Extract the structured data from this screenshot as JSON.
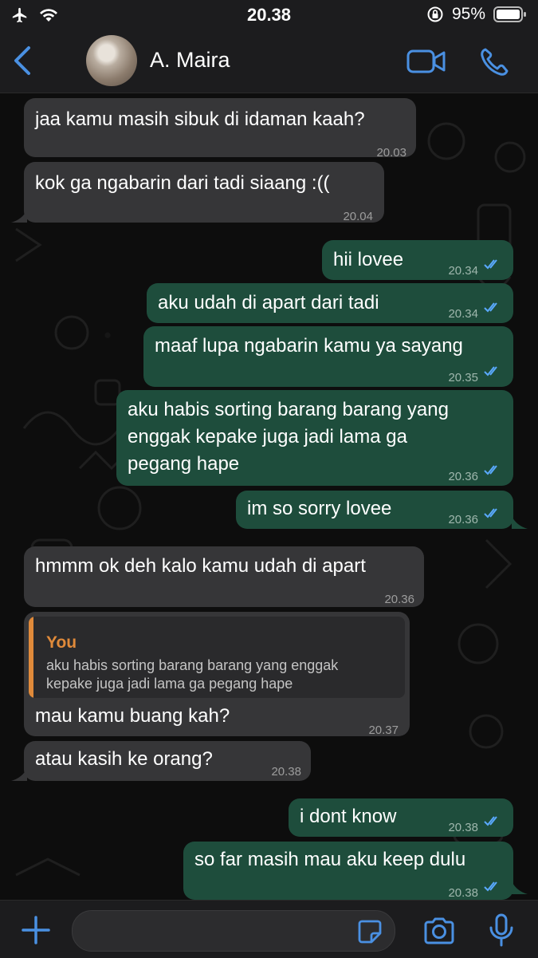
{
  "status_bar": {
    "time": "20.38",
    "battery": "95%"
  },
  "header": {
    "contact_name": "A. Maira"
  },
  "messages": [
    {
      "text": "jaa kamu masih sibuk di idaman kaah?",
      "time": "20.03",
      "direction": "incoming"
    },
    {
      "text": "kok ga ngabarin dari tadi siaang :((",
      "time": "20.04",
      "direction": "incoming"
    },
    {
      "text": "hii lovee",
      "time": "20.34",
      "direction": "outgoing",
      "status": "read"
    },
    {
      "text": "aku udah di apart dari tadi",
      "time": "20.34",
      "direction": "outgoing",
      "status": "read"
    },
    {
      "text": "maaf lupa ngabarin kamu ya sayang",
      "time": "20.35",
      "direction": "outgoing",
      "status": "read"
    },
    {
      "lines": [
        "aku habis sorting barang barang yang",
        "enggak kepake juga jadi lama ga",
        "pegang hape"
      ],
      "time": "20.36",
      "direction": "outgoing",
      "status": "read"
    },
    {
      "text": "im so sorry lovee",
      "time": "20.36",
      "direction": "outgoing",
      "status": "read"
    },
    {
      "text": "hmmm ok deh kalo kamu udah di apart",
      "time": "20.36",
      "direction": "incoming"
    },
    {
      "text": "mau kamu buang kah?",
      "time": "20.37",
      "direction": "incoming",
      "quote": {
        "author": "You",
        "lines": [
          "aku habis sorting barang barang yang enggak",
          "kepake juga jadi lama ga pegang hape"
        ]
      }
    },
    {
      "text": "atau kasih ke orang?",
      "time": "20.38",
      "direction": "incoming"
    },
    {
      "text": "i dont know",
      "time": "20.38",
      "direction": "outgoing",
      "status": "read"
    },
    {
      "text": "so far masih mau aku keep dulu",
      "time": "20.38",
      "direction": "outgoing",
      "status": "read"
    }
  ],
  "colors": {
    "incoming_bubble": "#363638",
    "outgoing_bubble": "#1e4d3c",
    "accent_blue": "#4a90e2",
    "quote_accent": "#e08a3a",
    "read_ticks": "#5aa9ff"
  },
  "icons": {
    "status_left": [
      "airplane-icon",
      "wifi-icon"
    ],
    "status_right": [
      "orientation-lock-icon",
      "battery-icon"
    ],
    "header": [
      "back-chevron-icon",
      "video-call-icon",
      "phone-icon"
    ],
    "composer": [
      "plus-icon",
      "sticker-icon",
      "camera-icon",
      "microphone-icon"
    ]
  }
}
